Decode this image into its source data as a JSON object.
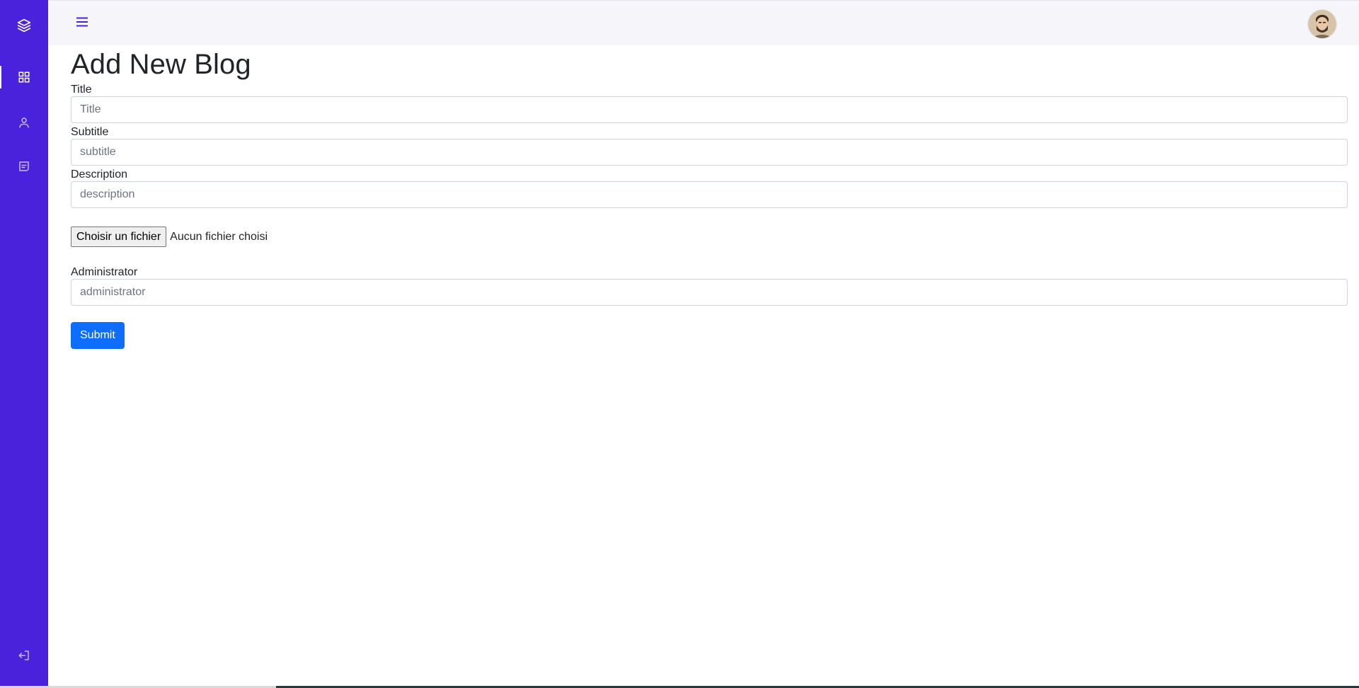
{
  "sidebar": {
    "items": [
      {
        "icon": "layers-icon",
        "label": ""
      },
      {
        "icon": "grid-icon",
        "active": true
      },
      {
        "icon": "user-icon"
      },
      {
        "icon": "message-icon"
      }
    ],
    "logout_icon": "logout-icon"
  },
  "topbar": {
    "menu_icon": "hamburger-icon",
    "avatar": "profile-avatar"
  },
  "page": {
    "title": "Add New Blog"
  },
  "form": {
    "title_label": "Title",
    "title_placeholder": "Title",
    "subtitle_label": "Subtitle",
    "subtitle_placeholder": "subtitle",
    "description_label": "Description",
    "description_placeholder": "description",
    "file_button_label": "Choisir un fichier",
    "file_status": "Aucun fichier choisi",
    "administrator_label": "Administrator",
    "administrator_placeholder": "administrator",
    "submit_label": "Submit"
  },
  "colors": {
    "sidebar_bg": "#4a22dc",
    "topbar_bg": "#f6f6fa",
    "primary_button": "#0d6efd"
  }
}
